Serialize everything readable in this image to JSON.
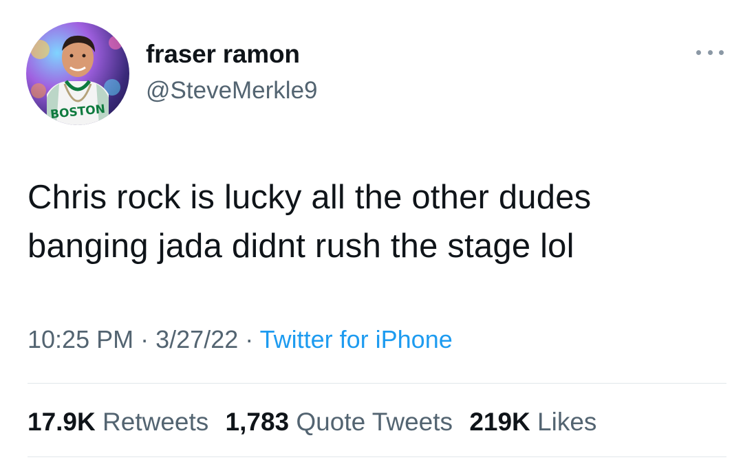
{
  "author": {
    "display_name": "fraser ramon",
    "handle": "@SteveMerkle9",
    "avatar_jersey_text": "BOSTON"
  },
  "tweet": {
    "text": "Chris rock is lucky all the other dudes\nbanging jada didnt rush the stage lol"
  },
  "meta": {
    "time": "10:25 PM",
    "date": "3/27/22",
    "separator": "·",
    "source": "Twitter for iPhone"
  },
  "stats": {
    "retweets_count": "17.9K",
    "retweets_label": "Retweets",
    "quotes_count": "1,783",
    "quotes_label": "Quote Tweets",
    "likes_count": "219K",
    "likes_label": "Likes"
  },
  "icons": {
    "more": "more-options-icon"
  },
  "colors": {
    "primary_text": "#0f1419",
    "secondary_text": "#536471",
    "link": "#1d9bf0",
    "divider": "#e1e6ea"
  }
}
